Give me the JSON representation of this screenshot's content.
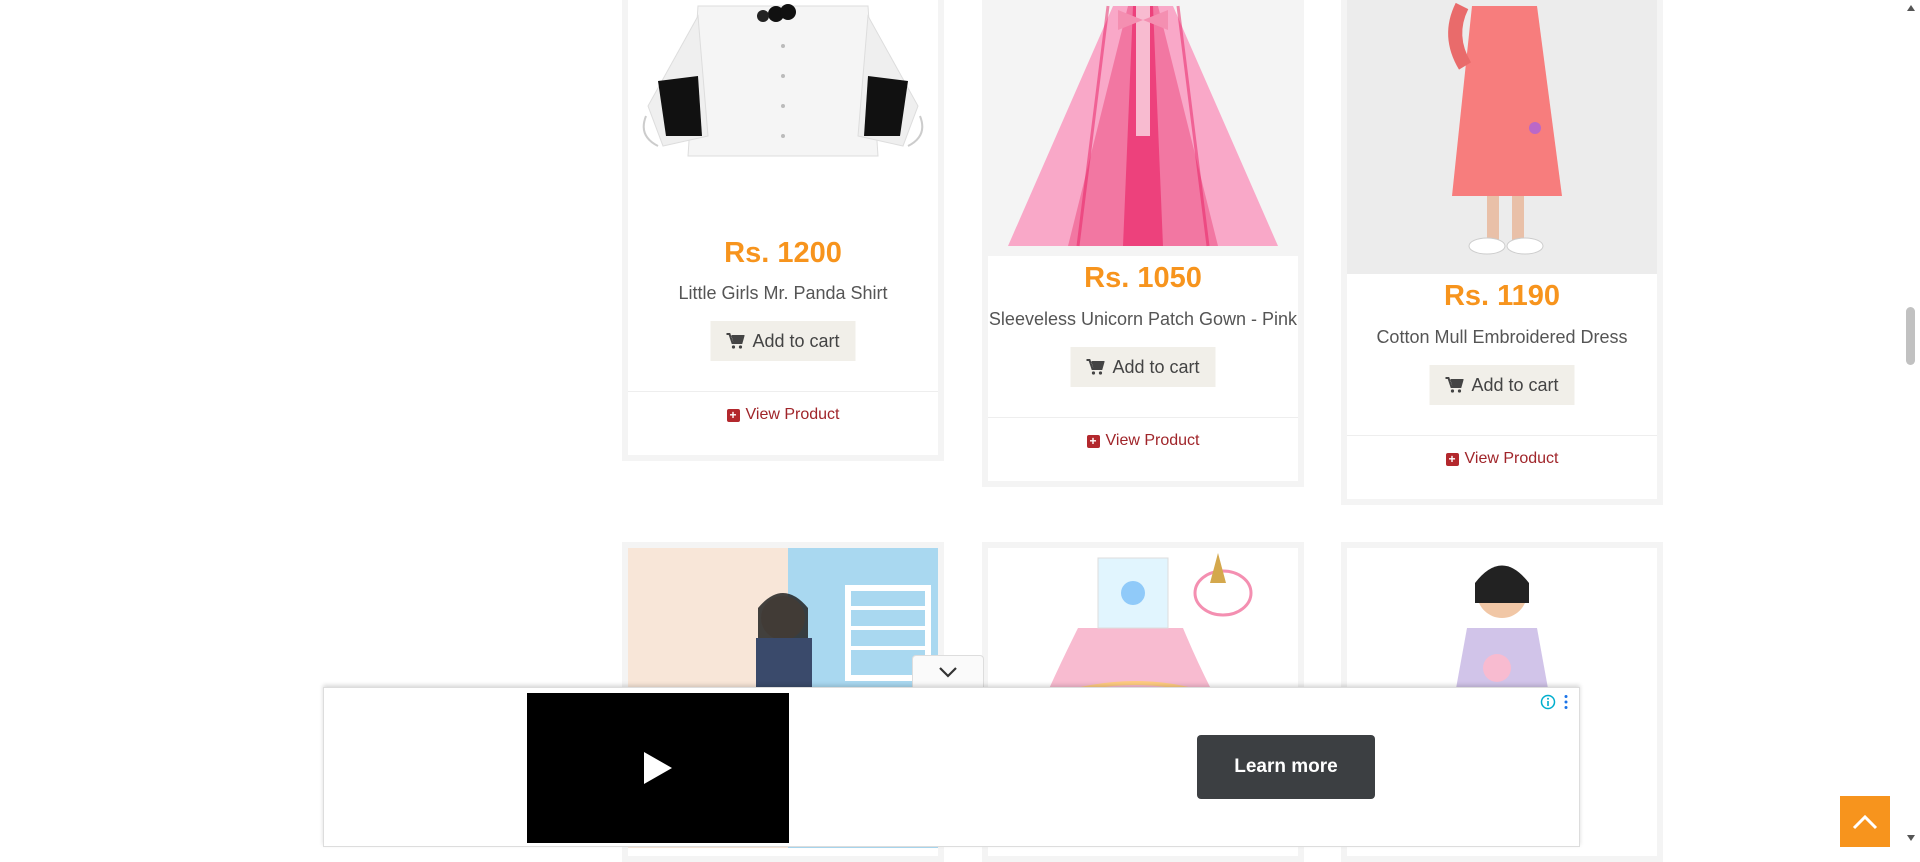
{
  "products": [
    {
      "price": "Rs. 1200",
      "name": "Little Girls Mr. Panda Shirt",
      "cart_label": "Add to cart",
      "view_label": "View Product"
    },
    {
      "price": "Rs. 1050",
      "name": "Sleeveless Unicorn Patch Gown - Pink",
      "cart_label": "Add to cart",
      "view_label": "View Product"
    },
    {
      "price": "Rs. 1190",
      "name": "Cotton Mull Embroidered Dress",
      "cart_label": "Add to cart",
      "view_label": "View Product"
    }
  ],
  "ad": {
    "cta_label": "Learn more"
  },
  "colors": {
    "price": "#f7941d",
    "link": "#a0252a",
    "back_to_top": "#f7941d"
  },
  "icons": [
    "cart-icon",
    "plus-square-icon",
    "play-icon",
    "chevron-down-icon",
    "info-icon",
    "more-vertical-icon",
    "chevron-up-icon"
  ]
}
